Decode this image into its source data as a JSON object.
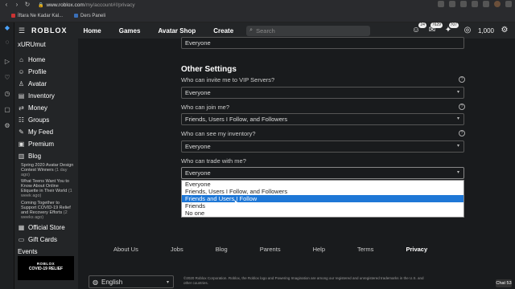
{
  "browser": {
    "url_domain": "www.roblox.com",
    "url_path": "/my/account#!/privacy",
    "bookmarks": [
      {
        "label": "İftara Ne Kadar Kal..."
      },
      {
        "label": "Ders Paneli"
      }
    ]
  },
  "topnav": {
    "logo": "ROBLOX",
    "links": [
      "Home",
      "Games",
      "Avatar Shop",
      "Create"
    ],
    "search_placeholder": "Search",
    "badge_friends": "24",
    "badge_messages": "7629",
    "badge_notifications": "707",
    "robux": "1,000"
  },
  "sidebar": {
    "username": "xURUmut",
    "items": [
      "Home",
      "Profile",
      "Avatar",
      "Inventory",
      "Money",
      "Groups",
      "My Feed",
      "Premium",
      "Blog"
    ],
    "blog_posts": [
      {
        "title": "Spring 2020 Avatar Design Contest Winners",
        "age": "(1 day ago)"
      },
      {
        "title": "What Teens Want You to Know About Online Etiquette in Their World",
        "age": "(1 week ago)"
      },
      {
        "title": "Coming Together to Support COVID-19 Relief and Recovery Efforts",
        "age": "(2 weeks ago)"
      }
    ],
    "store_items": [
      "Official Store",
      "Gift Cards"
    ],
    "events_label": "Events",
    "event_banner_line1": "ROBLOX",
    "event_banner_line2": "COVID-19 RELIEF"
  },
  "settings": {
    "top_value": "Everyone",
    "section_title": "Other Settings",
    "rows": [
      {
        "label": "Who can invite me to VIP Servers?",
        "value": "Everyone"
      },
      {
        "label": "Who can join me?",
        "value": "Friends, Users I Follow, and Followers"
      },
      {
        "label": "Who can see my inventory?",
        "value": "Everyone"
      },
      {
        "label": "Who can trade with me?",
        "value": "Everyone"
      }
    ],
    "trade_options": [
      "Everyone",
      "Friends, Users I Follow, and Followers",
      "Friends and Users I Follow",
      "Friends",
      "No one"
    ],
    "trade_selected_index": 2
  },
  "footer": {
    "links": [
      "About Us",
      "Jobs",
      "Blog",
      "Parents",
      "Help",
      "Terms",
      "Privacy"
    ],
    "active_link": "Privacy",
    "language": "English",
    "copyright": "©2020 Roblox Corporation. Roblox, the Roblox logo and Powering Imagination are among our registered and unregistered trademarks in the U.S. and other countries.",
    "chat_label": "Chat",
    "chat_count": "53"
  }
}
